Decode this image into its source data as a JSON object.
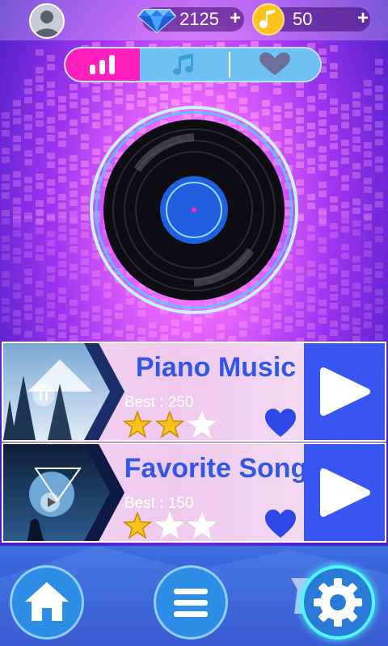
{
  "header": {
    "avatar_icon": "user-avatar-icon",
    "gems": {
      "icon": "diamond-icon",
      "value": "2125",
      "plus": "+"
    },
    "notes": {
      "icon": "music-note-coin-icon",
      "value": "50",
      "plus": "+"
    }
  },
  "tabs": [
    {
      "icon": "bars-chart-icon",
      "active": true
    },
    {
      "icon": "music-notes-icon",
      "active": false
    },
    {
      "icon": "heart-icon",
      "active": false
    }
  ],
  "center": {
    "icon": "vinyl-record-icon"
  },
  "songs": [
    {
      "title": "Piano Music",
      "best": "Best : 250",
      "stars": 2,
      "max_stars": 3,
      "favorite": true,
      "thumbnail": "winter-forest-thumbnail"
    },
    {
      "title": "Favorite Song",
      "best": "Best : 150",
      "stars": 1,
      "max_stars": 3,
      "favorite": true,
      "thumbnail": "night-deer-thumbnail"
    }
  ],
  "bottom_nav": [
    {
      "icon": "home-icon"
    },
    {
      "icon": "menu-icon"
    },
    {
      "icon": "gear-icon"
    }
  ],
  "colors": {
    "tab_active": "#ff1fbf",
    "tab_bg": "#6fc1f5",
    "title_blue": "#3057e8",
    "play_blue": "#3a56f2",
    "coin_gold": "#ffc21a"
  }
}
